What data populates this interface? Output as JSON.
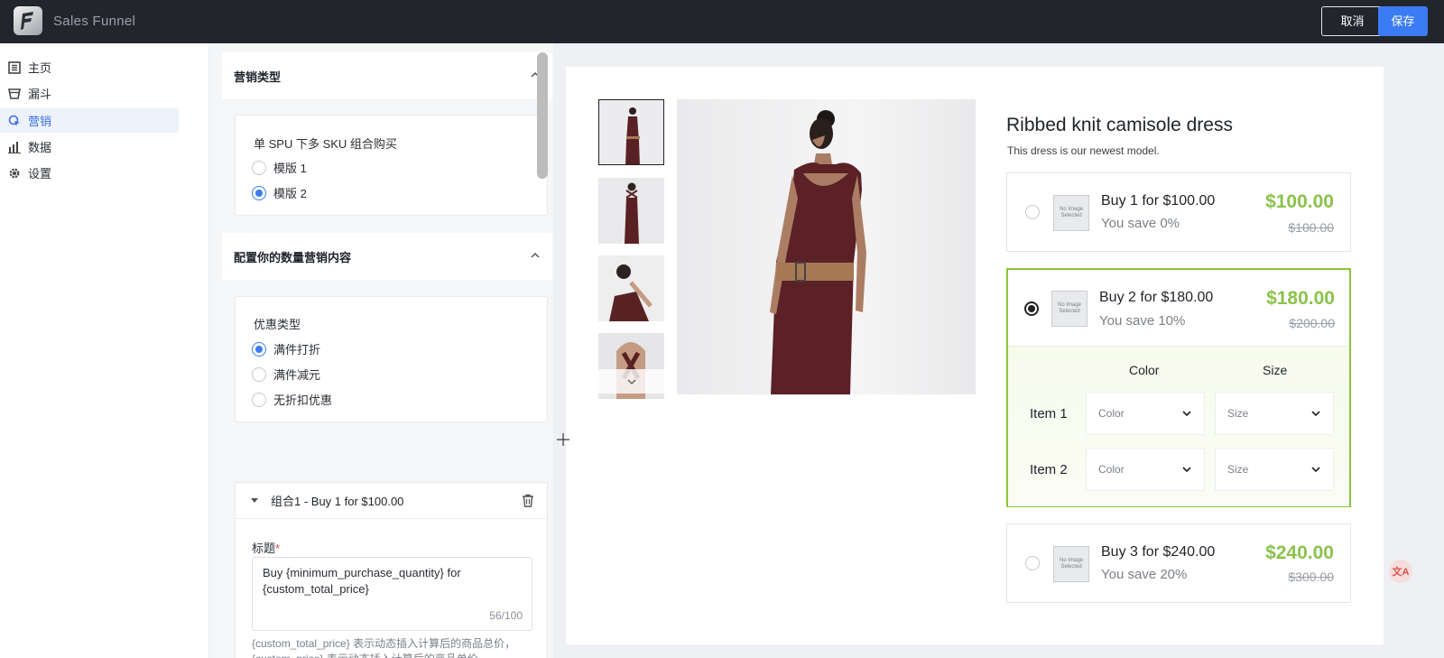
{
  "header": {
    "app_title": "Sales Funnel",
    "cancel_label": "取消",
    "save_label": "保存"
  },
  "nav": {
    "items": [
      {
        "label": "主页",
        "icon": "list-icon",
        "active": false
      },
      {
        "label": "漏斗",
        "icon": "funnel-icon",
        "active": false
      },
      {
        "label": "营销",
        "icon": "marketing-icon",
        "active": true
      },
      {
        "label": "数据",
        "icon": "bar-chart-icon",
        "active": false
      },
      {
        "label": "设置",
        "icon": "gear-icon",
        "active": false
      }
    ]
  },
  "panel": {
    "section1": {
      "title": "营销类型",
      "card_title": "单 SPU 下多 SKU 组合购买",
      "options": [
        {
          "label": "模版 1",
          "checked": false
        },
        {
          "label": "模版 2",
          "checked": true
        }
      ]
    },
    "section2": {
      "title": "配置你的数量营销内容",
      "card_title": "优惠类型",
      "options": [
        {
          "label": "满件打折",
          "checked": true
        },
        {
          "label": "满件减元",
          "checked": false
        },
        {
          "label": "无折扣优惠",
          "checked": false
        }
      ]
    },
    "combo": {
      "title": "组合1 - Buy 1 for $100.00",
      "field_label": "标题",
      "required_mark": "*",
      "value": "Buy {minimum_purchase_quantity} for {custom_total_price}",
      "counter": "56/100",
      "help": "{custom_total_price} 表示动态插入计算后的商品总价，{custom_price} 表示动态插入计算后的商品单价，{minimum_purchase_quantity} 表示动态插入的购买数量"
    }
  },
  "preview": {
    "product_title": "Ribbed knit camisole dress",
    "product_desc": "This dress is our newest model.",
    "no_image_text": "No Image Selected",
    "offers": [
      {
        "label": "Buy 1 for $100.00",
        "save": "You save 0%",
        "price": "$100.00",
        "old_price": "$100.00",
        "selected": false
      },
      {
        "label": "Buy 2 for $180.00",
        "save": "You save 10%",
        "price": "$180.00",
        "old_price": "$200.00",
        "selected": true
      },
      {
        "label": "Buy 3 for $240.00",
        "save": "You save 20%",
        "price": "$240.00",
        "old_price": "$300.00",
        "selected": false
      }
    ],
    "variant": {
      "col_color": "Color",
      "col_size": "Size",
      "rows": [
        {
          "label": "Item 1",
          "color_placeholder": "Color",
          "size_placeholder": "Size"
        },
        {
          "label": "Item 2",
          "color_placeholder": "Color",
          "size_placeholder": "Size"
        }
      ]
    }
  },
  "colors": {
    "accent": "#3b7cf4",
    "price_green": "#8bc34a",
    "topbar": "#23252d"
  }
}
